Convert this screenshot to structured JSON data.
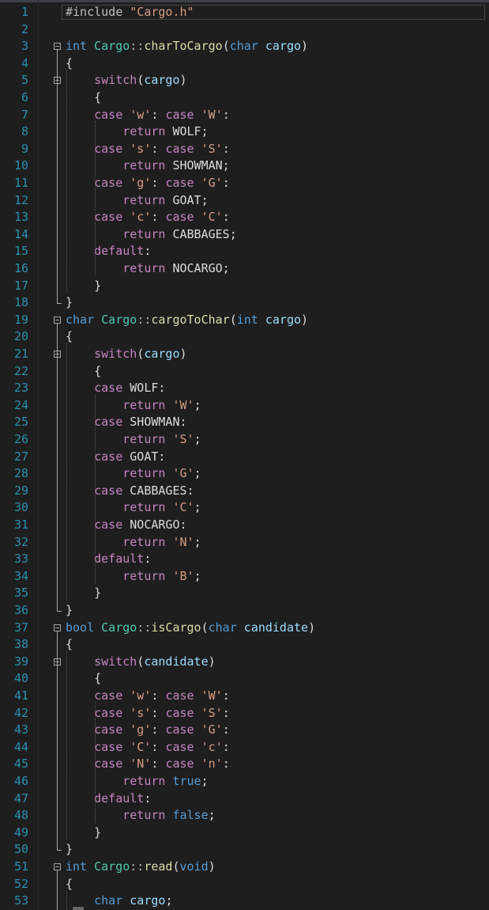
{
  "editor": {
    "language": "cpp",
    "lines": [
      {
        "n": "1",
        "tokens": [
          [
            "m",
            "#include "
          ],
          [
            "s",
            "\"Cargo.h\""
          ]
        ]
      },
      {
        "n": "2",
        "tokens": []
      },
      {
        "n": "3",
        "tokens": [
          [
            "k",
            "int"
          ],
          [
            "c",
            " "
          ],
          [
            "t",
            "Cargo"
          ],
          [
            "op",
            "::"
          ],
          [
            "f",
            "charToCargo"
          ],
          [
            "c",
            "("
          ],
          [
            "k",
            "char"
          ],
          [
            "c",
            " "
          ],
          [
            "v",
            "cargo"
          ],
          [
            "c",
            ")"
          ]
        ]
      },
      {
        "n": "4",
        "tokens": [
          [
            "c",
            "{"
          ]
        ]
      },
      {
        "n": "5",
        "tokens": [
          [
            "c",
            "    "
          ],
          [
            "p",
            "switch"
          ],
          [
            "c",
            "("
          ],
          [
            "v",
            "cargo"
          ],
          [
            "c",
            ")"
          ]
        ]
      },
      {
        "n": "6",
        "tokens": [
          [
            "c",
            "    {"
          ]
        ]
      },
      {
        "n": "7",
        "tokens": [
          [
            "c",
            "    "
          ],
          [
            "p",
            "case"
          ],
          [
            "c",
            " "
          ],
          [
            "s",
            "'w'"
          ],
          [
            "c",
            ": "
          ],
          [
            "p",
            "case"
          ],
          [
            "c",
            " "
          ],
          [
            "s",
            "'W'"
          ],
          [
            "c",
            ":"
          ]
        ]
      },
      {
        "n": "8",
        "tokens": [
          [
            "c",
            "        "
          ],
          [
            "p",
            "return"
          ],
          [
            "c",
            " WOLF;"
          ]
        ]
      },
      {
        "n": "9",
        "tokens": [
          [
            "c",
            "    "
          ],
          [
            "p",
            "case"
          ],
          [
            "c",
            " "
          ],
          [
            "s",
            "'s'"
          ],
          [
            "c",
            ": "
          ],
          [
            "p",
            "case"
          ],
          [
            "c",
            " "
          ],
          [
            "s",
            "'S'"
          ],
          [
            "c",
            ":"
          ]
        ]
      },
      {
        "n": "10",
        "tokens": [
          [
            "c",
            "        "
          ],
          [
            "p",
            "return"
          ],
          [
            "c",
            " SHOWMAN;"
          ]
        ]
      },
      {
        "n": "11",
        "tokens": [
          [
            "c",
            "    "
          ],
          [
            "p",
            "case"
          ],
          [
            "c",
            " "
          ],
          [
            "s",
            "'g'"
          ],
          [
            "c",
            ": "
          ],
          [
            "p",
            "case"
          ],
          [
            "c",
            " "
          ],
          [
            "s",
            "'G'"
          ],
          [
            "c",
            ":"
          ]
        ]
      },
      {
        "n": "12",
        "tokens": [
          [
            "c",
            "        "
          ],
          [
            "p",
            "return"
          ],
          [
            "c",
            " GOAT;"
          ]
        ]
      },
      {
        "n": "13",
        "tokens": [
          [
            "c",
            "    "
          ],
          [
            "p",
            "case"
          ],
          [
            "c",
            " "
          ],
          [
            "s",
            "'c'"
          ],
          [
            "c",
            ": "
          ],
          [
            "p",
            "case"
          ],
          [
            "c",
            " "
          ],
          [
            "s",
            "'C'"
          ],
          [
            "c",
            ":"
          ]
        ]
      },
      {
        "n": "14",
        "tokens": [
          [
            "c",
            "        "
          ],
          [
            "p",
            "return"
          ],
          [
            "c",
            " CABBAGES;"
          ]
        ]
      },
      {
        "n": "15",
        "tokens": [
          [
            "c",
            "    "
          ],
          [
            "p",
            "default"
          ],
          [
            "c",
            ":"
          ]
        ]
      },
      {
        "n": "16",
        "tokens": [
          [
            "c",
            "        "
          ],
          [
            "p",
            "return"
          ],
          [
            "c",
            " NOCARGO;"
          ]
        ]
      },
      {
        "n": "17",
        "tokens": [
          [
            "c",
            "    }"
          ]
        ]
      },
      {
        "n": "18",
        "tokens": [
          [
            "c",
            "}"
          ]
        ]
      },
      {
        "n": "19",
        "tokens": [
          [
            "k",
            "char"
          ],
          [
            "c",
            " "
          ],
          [
            "t",
            "Cargo"
          ],
          [
            "op",
            "::"
          ],
          [
            "f",
            "cargoToChar"
          ],
          [
            "c",
            "("
          ],
          [
            "k",
            "int"
          ],
          [
            "c",
            " "
          ],
          [
            "v",
            "cargo"
          ],
          [
            "c",
            ")"
          ]
        ]
      },
      {
        "n": "20",
        "tokens": [
          [
            "c",
            "{"
          ]
        ]
      },
      {
        "n": "21",
        "tokens": [
          [
            "c",
            "    "
          ],
          [
            "p",
            "switch"
          ],
          [
            "c",
            "("
          ],
          [
            "v",
            "cargo"
          ],
          [
            "c",
            ")"
          ]
        ]
      },
      {
        "n": "22",
        "tokens": [
          [
            "c",
            "    {"
          ]
        ]
      },
      {
        "n": "23",
        "tokens": [
          [
            "c",
            "    "
          ],
          [
            "p",
            "case"
          ],
          [
            "c",
            " WOLF:"
          ]
        ]
      },
      {
        "n": "24",
        "tokens": [
          [
            "c",
            "        "
          ],
          [
            "p",
            "return"
          ],
          [
            "c",
            " "
          ],
          [
            "s",
            "'W'"
          ],
          [
            "c",
            ";"
          ]
        ]
      },
      {
        "n": "25",
        "tokens": [
          [
            "c",
            "    "
          ],
          [
            "p",
            "case"
          ],
          [
            "c",
            " SHOWMAN:"
          ]
        ]
      },
      {
        "n": "26",
        "tokens": [
          [
            "c",
            "        "
          ],
          [
            "p",
            "return"
          ],
          [
            "c",
            " "
          ],
          [
            "s",
            "'S'"
          ],
          [
            "c",
            ";"
          ]
        ]
      },
      {
        "n": "27",
        "tokens": [
          [
            "c",
            "    "
          ],
          [
            "p",
            "case"
          ],
          [
            "c",
            " GOAT:"
          ]
        ]
      },
      {
        "n": "28",
        "tokens": [
          [
            "c",
            "        "
          ],
          [
            "p",
            "return"
          ],
          [
            "c",
            " "
          ],
          [
            "s",
            "'G'"
          ],
          [
            "c",
            ";"
          ]
        ]
      },
      {
        "n": "29",
        "tokens": [
          [
            "c",
            "    "
          ],
          [
            "p",
            "case"
          ],
          [
            "c",
            " CABBAGES:"
          ]
        ]
      },
      {
        "n": "30",
        "tokens": [
          [
            "c",
            "        "
          ],
          [
            "p",
            "return"
          ],
          [
            "c",
            " "
          ],
          [
            "s",
            "'C'"
          ],
          [
            "c",
            ";"
          ]
        ]
      },
      {
        "n": "31",
        "tokens": [
          [
            "c",
            "    "
          ],
          [
            "p",
            "case"
          ],
          [
            "c",
            " NOCARGO:"
          ]
        ]
      },
      {
        "n": "32",
        "tokens": [
          [
            "c",
            "        "
          ],
          [
            "p",
            "return"
          ],
          [
            "c",
            " "
          ],
          [
            "s",
            "'N'"
          ],
          [
            "c",
            ";"
          ]
        ]
      },
      {
        "n": "33",
        "tokens": [
          [
            "c",
            "    "
          ],
          [
            "p",
            "default"
          ],
          [
            "c",
            ":"
          ]
        ]
      },
      {
        "n": "34",
        "tokens": [
          [
            "c",
            "        "
          ],
          [
            "p",
            "return"
          ],
          [
            "c",
            " "
          ],
          [
            "s",
            "'B'"
          ],
          [
            "c",
            ";"
          ]
        ]
      },
      {
        "n": "35",
        "tokens": [
          [
            "c",
            "    }"
          ]
        ]
      },
      {
        "n": "36",
        "tokens": [
          [
            "c",
            "}"
          ]
        ]
      },
      {
        "n": "37",
        "tokens": [
          [
            "k",
            "bool"
          ],
          [
            "c",
            " "
          ],
          [
            "t",
            "Cargo"
          ],
          [
            "op",
            "::"
          ],
          [
            "f",
            "isCargo"
          ],
          [
            "c",
            "("
          ],
          [
            "k",
            "char"
          ],
          [
            "c",
            " "
          ],
          [
            "v",
            "candidate"
          ],
          [
            "c",
            ")"
          ]
        ]
      },
      {
        "n": "38",
        "tokens": [
          [
            "c",
            "{"
          ]
        ]
      },
      {
        "n": "39",
        "tokens": [
          [
            "c",
            "    "
          ],
          [
            "p",
            "switch"
          ],
          [
            "c",
            "("
          ],
          [
            "v",
            "candidate"
          ],
          [
            "c",
            ")"
          ]
        ]
      },
      {
        "n": "40",
        "tokens": [
          [
            "c",
            "    {"
          ]
        ]
      },
      {
        "n": "41",
        "tokens": [
          [
            "c",
            "    "
          ],
          [
            "p",
            "case"
          ],
          [
            "c",
            " "
          ],
          [
            "s",
            "'w'"
          ],
          [
            "c",
            ": "
          ],
          [
            "p",
            "case"
          ],
          [
            "c",
            " "
          ],
          [
            "s",
            "'W'"
          ],
          [
            "c",
            ":"
          ]
        ]
      },
      {
        "n": "42",
        "tokens": [
          [
            "c",
            "    "
          ],
          [
            "p",
            "case"
          ],
          [
            "c",
            " "
          ],
          [
            "s",
            "'s'"
          ],
          [
            "c",
            ": "
          ],
          [
            "p",
            "case"
          ],
          [
            "c",
            " "
          ],
          [
            "s",
            "'S'"
          ],
          [
            "c",
            ":"
          ]
        ]
      },
      {
        "n": "43",
        "tokens": [
          [
            "c",
            "    "
          ],
          [
            "p",
            "case"
          ],
          [
            "c",
            " "
          ],
          [
            "s",
            "'g'"
          ],
          [
            "c",
            ": "
          ],
          [
            "p",
            "case"
          ],
          [
            "c",
            " "
          ],
          [
            "s",
            "'G'"
          ],
          [
            "c",
            ":"
          ]
        ]
      },
      {
        "n": "44",
        "tokens": [
          [
            "c",
            "    "
          ],
          [
            "p",
            "case"
          ],
          [
            "c",
            " "
          ],
          [
            "s",
            "'C'"
          ],
          [
            "c",
            ": "
          ],
          [
            "p",
            "case"
          ],
          [
            "c",
            " "
          ],
          [
            "s",
            "'c'"
          ],
          [
            "c",
            ":"
          ]
        ]
      },
      {
        "n": "45",
        "tokens": [
          [
            "c",
            "    "
          ],
          [
            "p",
            "case"
          ],
          [
            "c",
            " "
          ],
          [
            "s",
            "'N'"
          ],
          [
            "c",
            ": "
          ],
          [
            "p",
            "case"
          ],
          [
            "c",
            " "
          ],
          [
            "s",
            "'n'"
          ],
          [
            "c",
            ":"
          ]
        ]
      },
      {
        "n": "46",
        "tokens": [
          [
            "c",
            "        "
          ],
          [
            "p",
            "return"
          ],
          [
            "c",
            " "
          ],
          [
            "k",
            "true"
          ],
          [
            "c",
            ";"
          ]
        ]
      },
      {
        "n": "47",
        "tokens": [
          [
            "c",
            "    "
          ],
          [
            "p",
            "default"
          ],
          [
            "c",
            ":"
          ]
        ]
      },
      {
        "n": "48",
        "tokens": [
          [
            "c",
            "        "
          ],
          [
            "p",
            "return"
          ],
          [
            "c",
            " "
          ],
          [
            "k",
            "false"
          ],
          [
            "c",
            ";"
          ]
        ]
      },
      {
        "n": "49",
        "tokens": [
          [
            "c",
            "    }"
          ]
        ]
      },
      {
        "n": "50",
        "tokens": [
          [
            "c",
            "}"
          ]
        ]
      },
      {
        "n": "51",
        "tokens": [
          [
            "k",
            "int"
          ],
          [
            "c",
            " "
          ],
          [
            "t",
            "Cargo"
          ],
          [
            "op",
            "::"
          ],
          [
            "f",
            "read"
          ],
          [
            "c",
            "("
          ],
          [
            "k",
            "void"
          ],
          [
            "c",
            ")"
          ]
        ]
      },
      {
        "n": "52",
        "tokens": [
          [
            "c",
            "{"
          ]
        ]
      },
      {
        "n": "53",
        "tokens": [
          [
            "c",
            "    "
          ],
          [
            "k",
            "char"
          ],
          [
            "c",
            " "
          ],
          [
            "v",
            "cargo"
          ],
          [
            "c",
            ";"
          ]
        ]
      }
    ],
    "active_line": "1",
    "fold_markers": [
      "3",
      "5",
      "19",
      "21",
      "37",
      "39",
      "51"
    ]
  },
  "colors": {
    "background": "#1e1e1e",
    "line_number": "#2b91af",
    "keyword": "#569cd6",
    "control": "#c586c0",
    "string": "#d69d85",
    "function": "#dcdcaa",
    "type": "#4ec9b0",
    "parameter": "#9cdcfe",
    "text": "#dcdcdc"
  }
}
